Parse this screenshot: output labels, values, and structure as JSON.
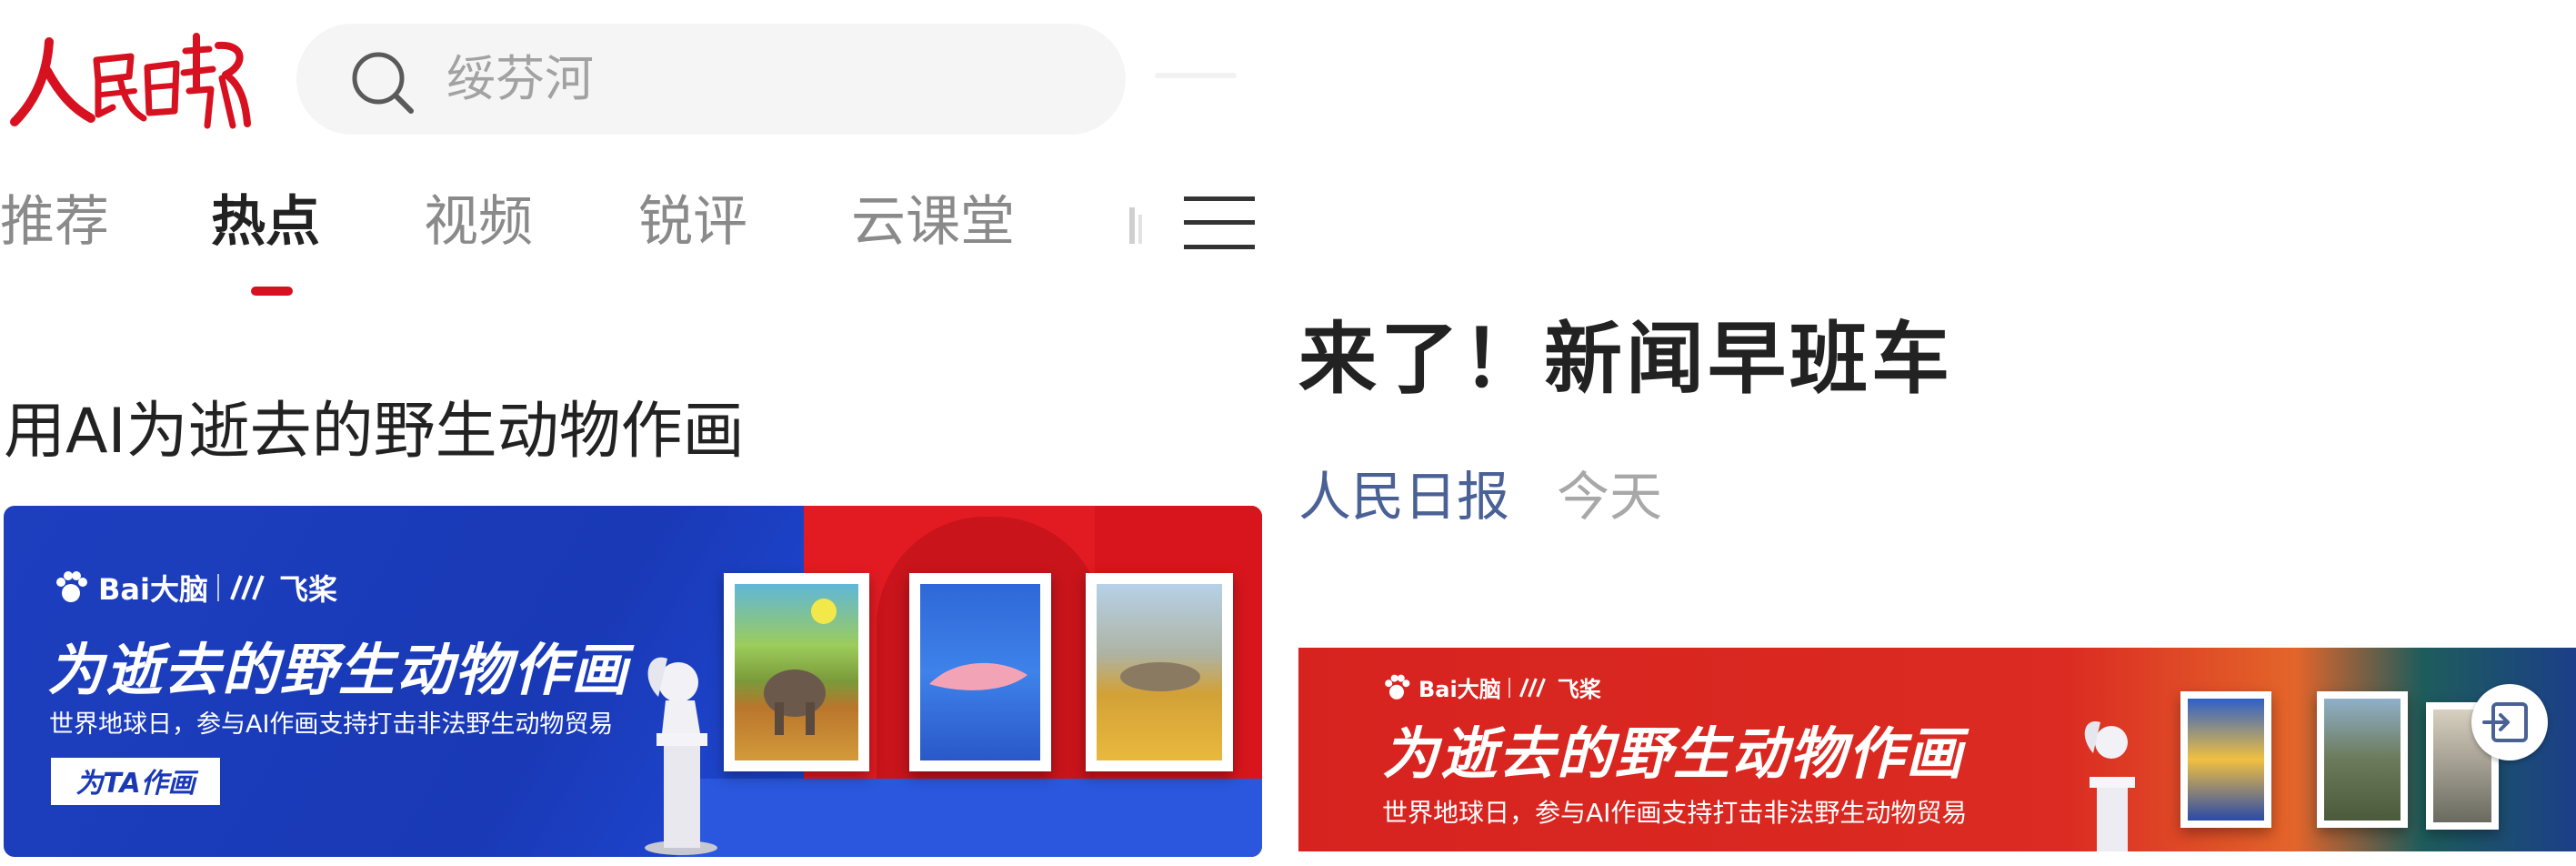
{
  "app": {
    "logo_text": "人民日报",
    "brand_color": "#d7111f"
  },
  "search": {
    "placeholder": "绥芬河",
    "icon": "search-icon"
  },
  "tabs": [
    {
      "label": "推荐",
      "active": false
    },
    {
      "label": "热点",
      "active": true
    },
    {
      "label": "视频",
      "active": false
    },
    {
      "label": "锐评",
      "active": false
    },
    {
      "label": "云课堂",
      "active": false
    }
  ],
  "tabs_menu_icon": "menu-icon",
  "feed": {
    "headline": "用AI为逝去的野生动物作画",
    "banner": {
      "brand_baidu": "Bai大脑",
      "brand_feijiang": "飞桨",
      "title": "为逝去的野生动物作画",
      "subtitle": "世界地球日，参与AI作画支持打击非法野生动物贸易",
      "cta": "为TA作画"
    }
  },
  "article": {
    "title": "来了！新闻早班车",
    "source": "人民日报",
    "time": "今天",
    "source_color": "#4a6196",
    "banner": {
      "brand_baidu": "Bai大脑",
      "brand_feijiang": "飞桨",
      "title": "为逝去的野生动物作画",
      "subtitle": "世界地球日，参与AI作画支持打击非法野生动物贸易",
      "action_icon": "exit-icon"
    }
  }
}
